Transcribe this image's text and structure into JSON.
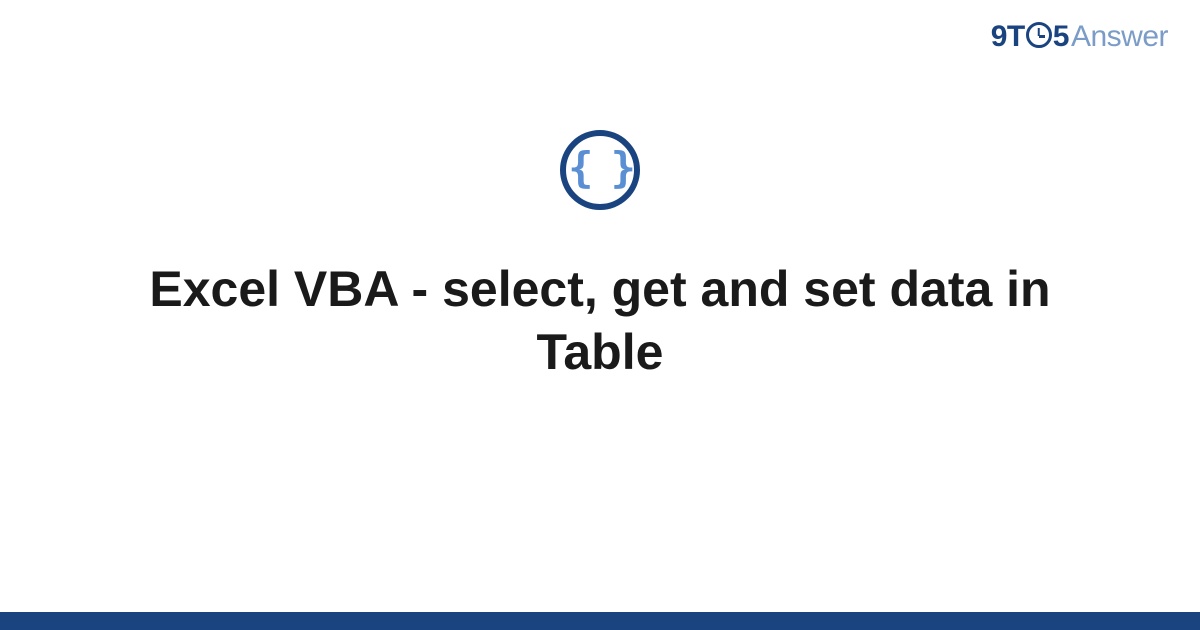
{
  "header": {
    "logo_part1": "9T",
    "logo_part2": "5",
    "logo_part3": "Answer"
  },
  "main": {
    "icon_braces": "{ }",
    "title": "Excel VBA - select, get and set data in Table"
  },
  "colors": {
    "brand_dark": "#1a4480",
    "brand_light": "#5b8fd4",
    "brand_muted": "#7a9cc6"
  }
}
